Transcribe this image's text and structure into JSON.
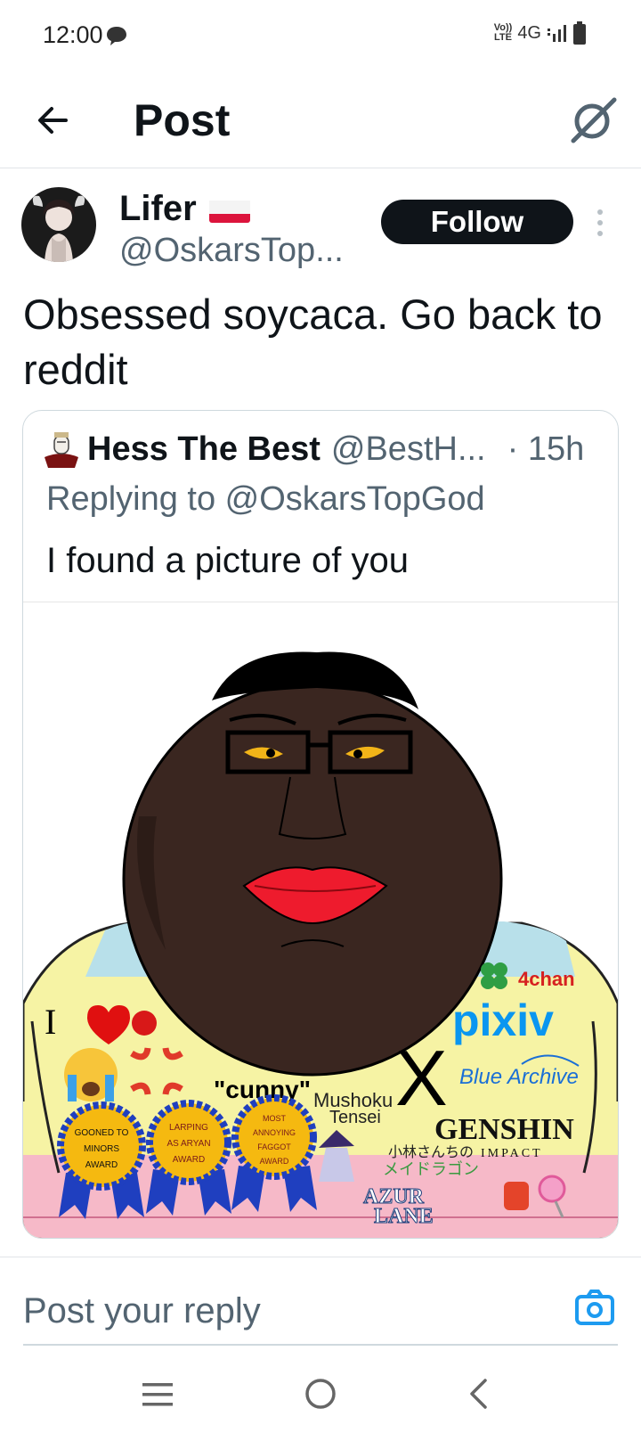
{
  "status_bar": {
    "time": "12:00",
    "volte_top": "Vo))",
    "volte_bottom": "LTE",
    "network": "4G",
    "icons": [
      "chat-bubble-icon",
      "signal-icon",
      "battery-icon"
    ]
  },
  "header": {
    "title": "Post",
    "back_icon": "arrow-left-icon",
    "right_icon": "grok-icon"
  },
  "post": {
    "author_name": "Lifer",
    "author_flag": "poland-flag",
    "author_handle": "@OskarsTop...",
    "follow_label": "Follow",
    "text": "Obsessed soycaca. Go back to reddit"
  },
  "quoted_post": {
    "author_name": "Hess The Best",
    "author_handle": "@BestH...",
    "time": "· 15h",
    "replying_to": "Replying to @OskarsTopGod",
    "text": "I found a picture of you",
    "image": {
      "labels": {
        "fourchan": "4chan",
        "pixiv": "pixiv",
        "blue_archive": "Blue Archive",
        "cunny": "\"cunny\"",
        "mushoku_1": "Mushoku",
        "mushoku_2": "Tensei",
        "genshin_1": "GENSHIN",
        "genshin_2": "IMPACT",
        "kobayashi_1": "小林さんちの",
        "kobayashi_2": "メイドラゴン",
        "azur_1": "AZUR",
        "azur_2": "LANE",
        "x_logo": "X",
        "i_text": "I",
        "award1_l1": "GOONED TO",
        "award1_l2": "MINORS",
        "award1_l3": "AWARD",
        "award2_l1": "LARPING",
        "award2_l2": "AS ARYAN",
        "award2_l3": "AWARD",
        "award3_l1": "MOST",
        "award3_l2": "ANNOYING",
        "award3_l3": "FAGGOT",
        "award3_l4": "AWARD"
      }
    }
  },
  "reply": {
    "placeholder": "Post your reply",
    "camera_icon": "camera-icon"
  },
  "nav_bar": {
    "icons": [
      "menu-icon",
      "home-circle-icon",
      "back-chevron-icon"
    ]
  },
  "colors": {
    "text_primary": "#0f1419",
    "text_secondary": "#536471",
    "border": "#cfd9de",
    "accent_blue": "#1d9bf0",
    "skin": "#3a2620",
    "lips": "#ee1b2d",
    "shirt_blue": "#b8e0ea",
    "shirt_yellow": "#f6f3a4",
    "shirt_pink": "#f6b9c8"
  }
}
